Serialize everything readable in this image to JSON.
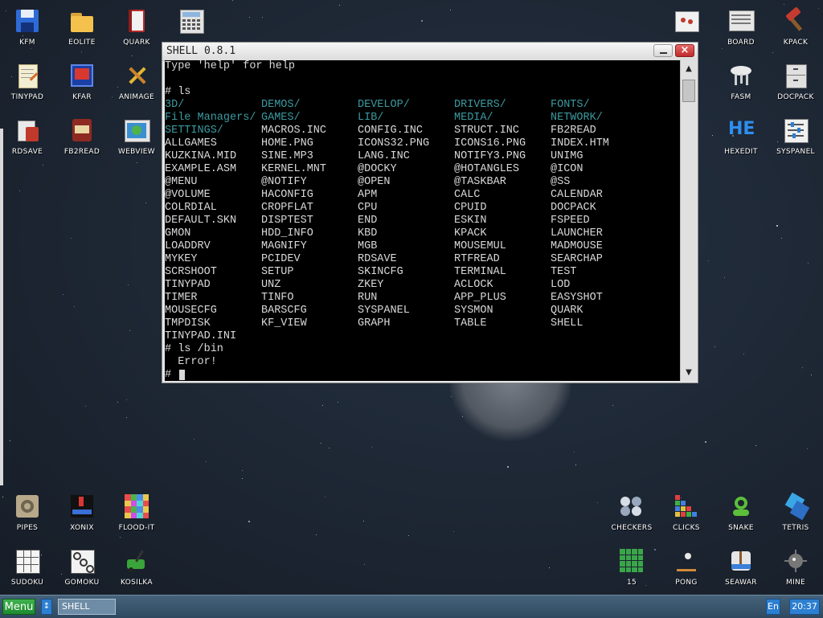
{
  "desktop": {
    "icons_top_left": [
      {
        "label": "KFM",
        "icon": "floppy-icon"
      },
      {
        "label": "EOLITE",
        "icon": "folder-icon"
      },
      {
        "label": "QUARK",
        "icon": "book-icon"
      },
      {
        "label": "TINYPAD",
        "icon": "notepad-icon"
      },
      {
        "label": "KFAR",
        "icon": "kfar-icon"
      },
      {
        "label": "ANIMAGE",
        "icon": "paint-icon"
      },
      {
        "label": "RDSAVE",
        "icon": "rdsave-icon"
      },
      {
        "label": "FB2READ",
        "icon": "fb2-book-icon"
      },
      {
        "label": "WEBVIEW",
        "icon": "globe-window-icon"
      }
    ],
    "icons_top_right": [
      {
        "label": "BOARD",
        "icon": "board-icon"
      },
      {
        "label": "KPACK",
        "icon": "hammer-icon"
      },
      {
        "label": "FASM",
        "icon": "fasm-icon"
      },
      {
        "label": "DOCPACK",
        "icon": "cabinet-icon"
      },
      {
        "label": "HEXEDIT",
        "icon": "hexedit-icon"
      },
      {
        "label": "SYSPANEL",
        "icon": "syspanel-icon"
      }
    ],
    "icons_bottom_left": [
      {
        "label": "PIPES",
        "icon": "pipes-icon"
      },
      {
        "label": "XONIX",
        "icon": "xonix-icon"
      },
      {
        "label": "FLOOD-IT",
        "icon": "flood-it-icon"
      },
      {
        "label": "SUDOKU",
        "icon": "sudoku-icon"
      },
      {
        "label": "GOMOKU",
        "icon": "gomoku-icon"
      },
      {
        "label": "KOSILKA",
        "icon": "lawnmower-icon"
      }
    ],
    "icons_bottom_right": [
      {
        "label": "CHECKERS",
        "icon": "checkers-icon"
      },
      {
        "label": "CLICKS",
        "icon": "clicks-icon"
      },
      {
        "label": "SNAKE",
        "icon": "snake-icon"
      },
      {
        "label": "TETRIS",
        "icon": "tetris-icon"
      },
      {
        "label": "15",
        "icon": "fifteen-icon"
      },
      {
        "label": "PONG",
        "icon": "pong-icon"
      },
      {
        "label": "SEAWAR",
        "icon": "seawar-icon"
      },
      {
        "label": "MINE",
        "icon": "mine-icon"
      }
    ]
  },
  "window": {
    "title": "SHELL 0.8.1",
    "close_glyph": "×",
    "scroll_up": "▲",
    "scroll_down": "▼",
    "terminal": {
      "intro": "Type 'help' for help",
      "cmd1": "# ls",
      "listing": [
        [
          "3D/",
          "DEMOS/",
          "DEVELOP/",
          "DRIVERS/",
          "FONTS/"
        ],
        [
          "File Managers/",
          "GAMES/",
          "LIB/",
          "MEDIA/",
          "NETWORK/"
        ],
        [
          "SETTINGS/",
          "MACROS.INC",
          "CONFIG.INC",
          "STRUCT.INC",
          "FB2READ"
        ],
        [
          "ALLGAMES",
          "HOME.PNG",
          "ICONS32.PNG",
          "ICONS16.PNG",
          "INDEX.HTM"
        ],
        [
          "KUZKINA.MID",
          "SINE.MP3",
          "LANG.INC",
          "NOTIFY3.PNG",
          "UNIMG"
        ],
        [
          "EXAMPLE.ASM",
          "KERNEL.MNT",
          "@DOCKY",
          "@HOTANGLES",
          "@ICON"
        ],
        [
          "@MENU",
          "@NOTIFY",
          "@OPEN",
          "@TASKBAR",
          "@SS"
        ],
        [
          "@VOLUME",
          "HACONFIG",
          "APM",
          "CALC",
          "CALENDAR"
        ],
        [
          "COLRDIAL",
          "CROPFLAT",
          "CPU",
          "CPUID",
          "DOCPACK"
        ],
        [
          "DEFAULT.SKN",
          "DISPTEST",
          "END",
          "ESKIN",
          "FSPEED"
        ],
        [
          "GMON",
          "HDD_INFO",
          "KBD",
          "KPACK",
          "LAUNCHER"
        ],
        [
          "LOADDRV",
          "MAGNIFY",
          "MGB",
          "MOUSEMUL",
          "MADMOUSE"
        ],
        [
          "MYKEY",
          "PCIDEV",
          "RDSAVE",
          "RTFREAD",
          "SEARCHAP"
        ],
        [
          "SCRSHOOT",
          "SETUP",
          "SKINCFG",
          "TERMINAL",
          "TEST"
        ],
        [
          "TINYPAD",
          "UNZ",
          "ZKEY",
          "ACLOCK",
          "LOD"
        ],
        [
          "TIMER",
          "TINFO",
          "RUN",
          "APP_PLUS",
          "EASYSHOT"
        ],
        [
          "MOUSECFG",
          "BARSCFG",
          "SYSPANEL",
          "SYSMON",
          "QUARK"
        ],
        [
          "TMPDISK",
          "KF_VIEW",
          "GRAPH",
          "TABLE",
          "SHELL"
        ],
        [
          "TINYPAD.INI",
          "",
          "",
          "",
          ""
        ]
      ],
      "dir_entries": [
        "3D/",
        "DEMOS/",
        "DEVELOP/",
        "DRIVERS/",
        "FONTS/",
        "File Managers/",
        "GAMES/",
        "LIB/",
        "MEDIA/",
        "NETWORK/",
        "SETTINGS/"
      ],
      "cmd2": "# ls /bin",
      "error": "  Error!",
      "prompt": "#"
    }
  },
  "taskbar": {
    "menu_label": "Menu",
    "switch_glyph": "↕",
    "task_label": "SHELL",
    "lang": "En",
    "clock": "20:37"
  }
}
